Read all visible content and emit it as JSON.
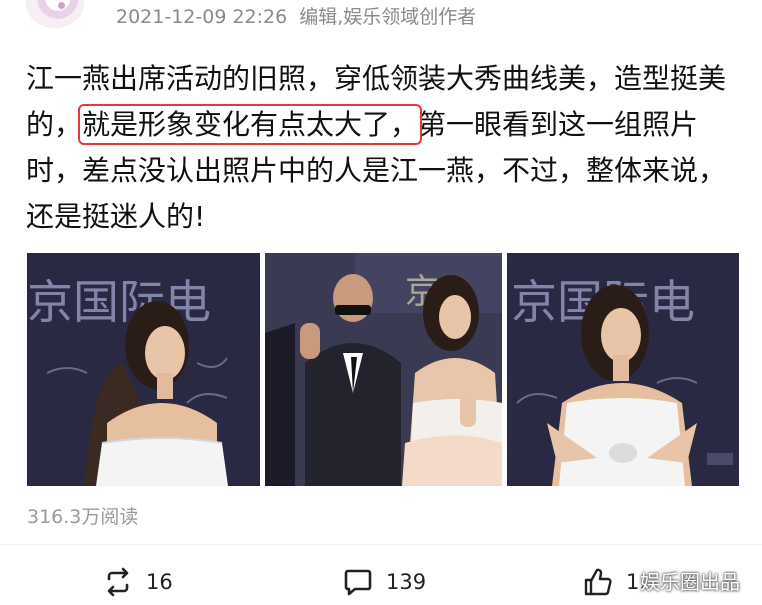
{
  "header": {
    "timestamp": "2021-12-09 22:26",
    "author_label": "编辑,娱乐领域创作者"
  },
  "post": {
    "text_before": "江一燕出席活动的旧照，穿低领装大秀曲线美，造型挺美的，",
    "text_highlight": "就是形象变化有点太大了，",
    "text_after": "第一眼看到这一组照片时，差点没认出照片中的人是江一燕，不过，整体来说，还是挺迷人的!",
    "highlight_color": "#e23a3a"
  },
  "photos": {
    "count": 3,
    "backdrop_text_1": "京国际电",
    "backdrop_text_2": "京国际电"
  },
  "stats": {
    "read_count": "316.3万阅读"
  },
  "actions": {
    "repost_count": "16",
    "comment_count": "139",
    "like_count": "1."
  },
  "watermark": {
    "text": "娱乐圈出品"
  }
}
